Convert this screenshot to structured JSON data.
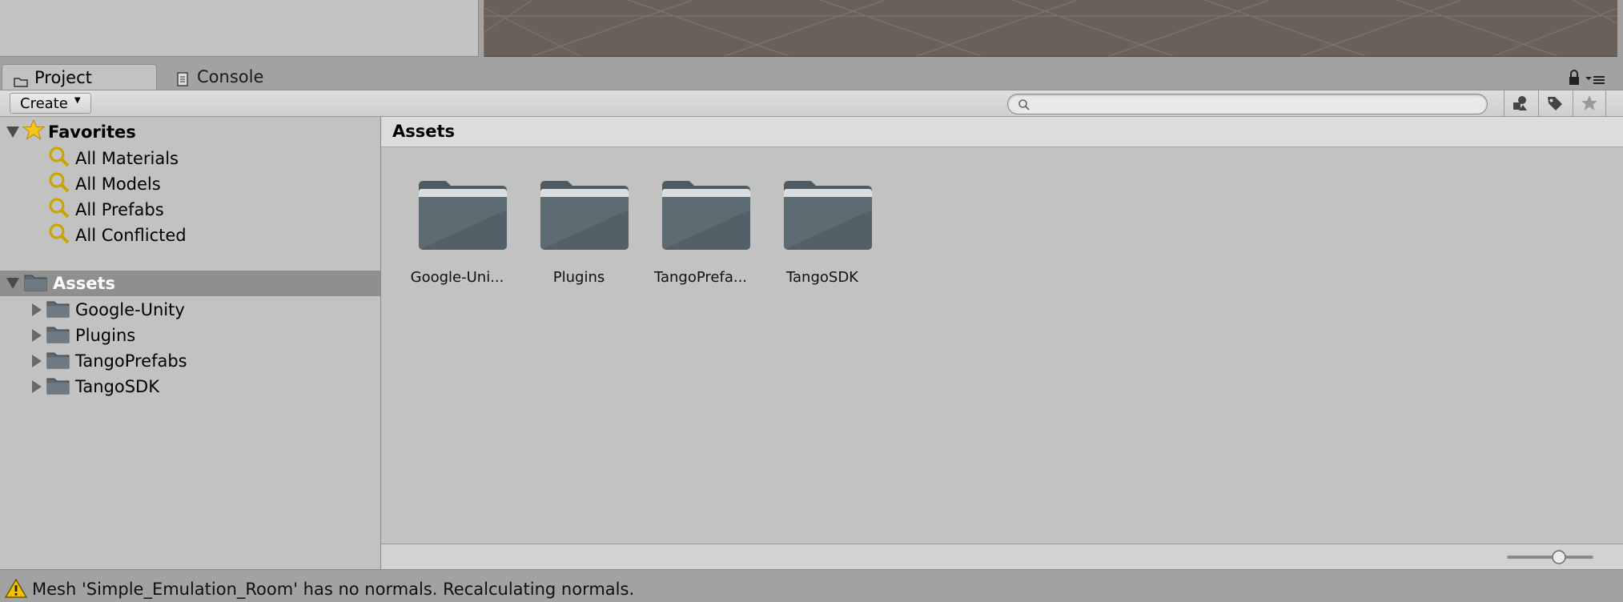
{
  "tabs": {
    "project_label": "Project",
    "console_label": "Console"
  },
  "toolbar": {
    "create_label": "Create",
    "search_placeholder": ""
  },
  "favorites": {
    "title": "Favorites",
    "items": [
      {
        "label": "All Materials"
      },
      {
        "label": "All Models"
      },
      {
        "label": "All Prefabs"
      },
      {
        "label": "All Conflicted"
      }
    ]
  },
  "tree": {
    "root_label": "Assets",
    "children": [
      {
        "label": "Google-Unity"
      },
      {
        "label": "Plugins"
      },
      {
        "label": "TangoPrefabs"
      },
      {
        "label": "TangoSDK"
      }
    ]
  },
  "content": {
    "breadcrumb": "Assets",
    "items": [
      {
        "label": "Google-Uni..."
      },
      {
        "label": "Plugins"
      },
      {
        "label": "TangoPrefa..."
      },
      {
        "label": "TangoSDK"
      }
    ]
  },
  "zoom_slider": {
    "value_fraction": 0.62
  },
  "status": {
    "message": "Mesh 'Simple_Emulation_Room' has no normals. Recalculating normals."
  },
  "icons": {
    "folder": "folder-icon",
    "favorite": "star-icon",
    "search": "search-icon",
    "warning": "warning-icon",
    "lock": "lock-icon",
    "menu": "menu-icon"
  },
  "colors": {
    "panel_bg": "#c2c2c2",
    "scene_bg": "#6a6059",
    "selected_row": "#8f8f8f",
    "folder_fill": "#5d6b73"
  }
}
